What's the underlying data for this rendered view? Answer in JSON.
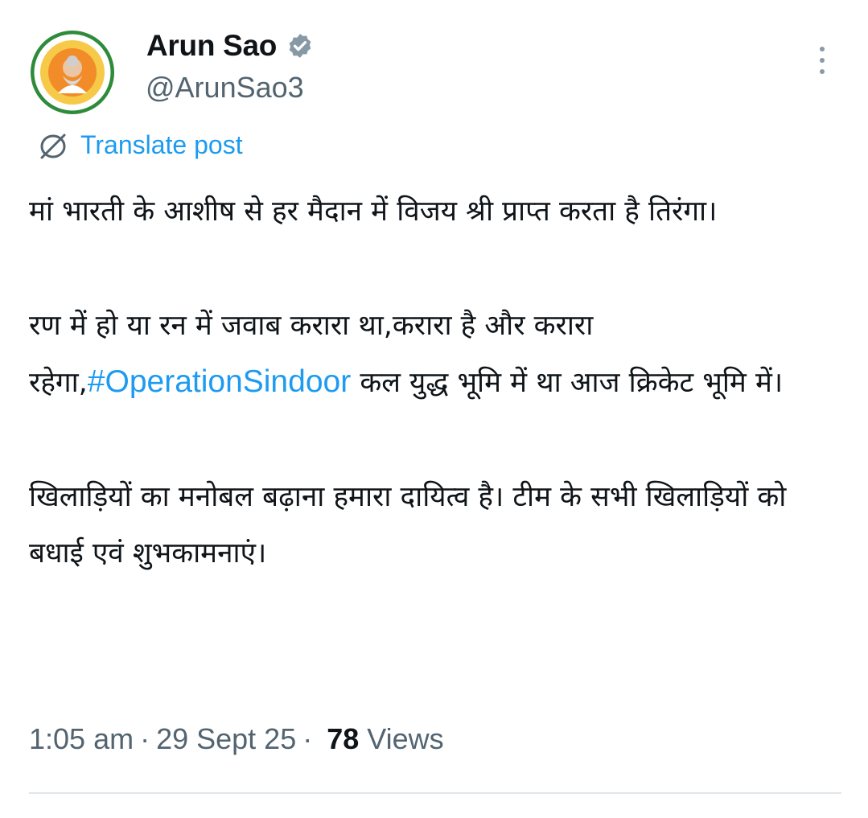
{
  "author": {
    "name": "Arun Sao",
    "handle": "@ArunSao3",
    "verified_icon": "verified-badge-icon",
    "avatar_icon": "avatar"
  },
  "translate": {
    "icon": "translate-globe-icon",
    "label": "Translate post"
  },
  "post": {
    "paragraph1": "मां भारती के आशीष से हर मैदान में विजय श्री प्राप्त करता है तिरंगा।",
    "paragraph2_before": "रण में हो या रन में जवाब करारा था,करारा है और करारा रहेगा,",
    "paragraph2_hashtag": "#OperationSindoor",
    "paragraph2_after": " कल युद्ध भूमि में था आज क्रिकेट भूमि में।",
    "paragraph3": "खिलाड़ियों का मनोबल बढ़ाना हमारा दायित्व है। टीम के सभी खिलाड़ियों को बधाई एवं शुभकामनाएं।"
  },
  "meta": {
    "time": "1:05 am",
    "separator": "·",
    "date": "29 Sept 25",
    "views_count": "78",
    "views_label": "Views"
  },
  "colors": {
    "text": "#0f1419",
    "secondary": "#536471",
    "link": "#1d9bf0",
    "avatar_ring": "#f28c28",
    "avatar_green": "#2e8b3a"
  }
}
